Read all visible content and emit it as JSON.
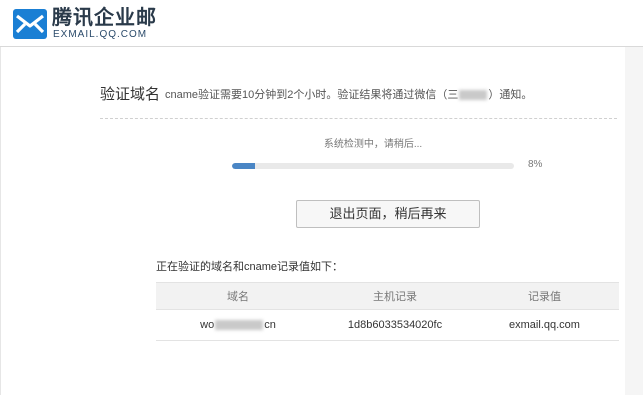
{
  "header": {
    "brand_name": "腾讯企业邮",
    "brand_domain": "EXMAIL.QQ.COM",
    "logo_icon": "mail-envelope-logo-icon",
    "brand_color": "#1a7fd4"
  },
  "verify": {
    "title": "验证域名",
    "desc_prefix": "cname验证需要10分钟到2个小时。验证结果将通过微信（",
    "desc_redacted_prefix": "三",
    "desc_suffix": "）通知。",
    "status_text": "系统检测中，请稍后...",
    "progress_percent": 8,
    "progress_label": "8%",
    "progress_color": "#4a86c5",
    "exit_button": "退出页面，稍后再来"
  },
  "records": {
    "caption": "正在验证的域名和cname记录值如下：",
    "columns": [
      "域名",
      "主机记录",
      "记录值"
    ],
    "rows": [
      {
        "domain_prefix": "wo",
        "domain_suffix": "cn",
        "host_record": "1d8b6033534020fc",
        "record_value": "exmail.qq.com"
      }
    ]
  }
}
